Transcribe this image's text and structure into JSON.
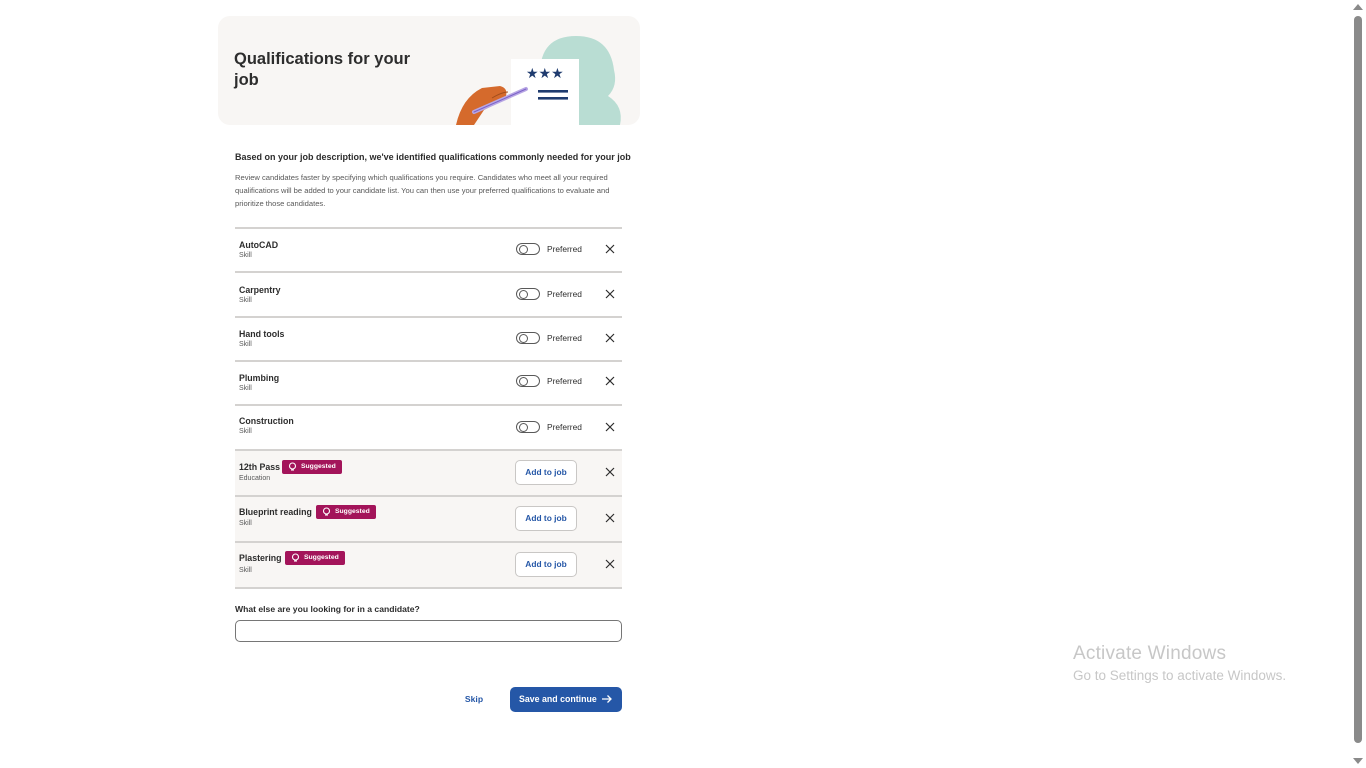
{
  "header": {
    "title": "Qualifications for your job"
  },
  "intro": {
    "heading": "Based on your job description, we've identified qualifications commonly needed for your job",
    "body": "Review candidates faster by specifying which qualifications you require. Candidates who meet all your required qualifications will be added to your candidate list. You can then use your preferred qualifications to evaluate and prioritize those candidates."
  },
  "qualifications": [
    {
      "name": "AutoCAD",
      "type": "Skill",
      "toggle_label": "Preferred",
      "preferred": false
    },
    {
      "name": "Carpentry",
      "type": "Skill",
      "toggle_label": "Preferred",
      "preferred": false
    },
    {
      "name": "Hand tools",
      "type": "Skill",
      "toggle_label": "Preferred",
      "preferred": false
    },
    {
      "name": "Plumbing",
      "type": "Skill",
      "toggle_label": "Preferred",
      "preferred": false
    },
    {
      "name": "Construction",
      "type": "Skill",
      "toggle_label": "Preferred",
      "preferred": false
    }
  ],
  "suggested": [
    {
      "name": "12th Pass",
      "type": "Education",
      "badge": "Suggested",
      "button": "Add to job"
    },
    {
      "name": "Blueprint reading",
      "type": "Skill",
      "badge": "Suggested",
      "button": "Add to job"
    },
    {
      "name": "Plastering",
      "type": "Skill",
      "badge": "Suggested",
      "button": "Add to job"
    }
  ],
  "other": {
    "label": "What else are you looking for in a candidate?",
    "value": "",
    "placeholder": ""
  },
  "footer": {
    "skip": "Skip",
    "save": "Save and continue"
  },
  "watermark": {
    "title": "Activate Windows",
    "subtitle": "Go to Settings to activate Windows."
  },
  "icons": {
    "close": "close-icon",
    "toggle": "toggle-switch",
    "suggested": "lightbulb-icon",
    "arrow": "arrow-right-icon"
  },
  "colors": {
    "primary": "#2557a7",
    "suggested_badge": "#a3145a",
    "card_bg": "#f8f6f4"
  }
}
